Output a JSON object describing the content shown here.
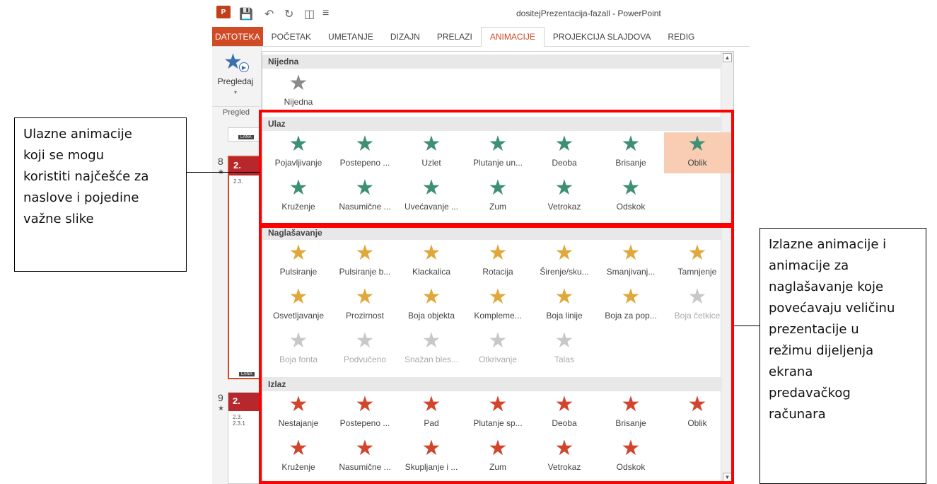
{
  "titlebar": {
    "app_icon_label": "P",
    "undo_icon": "undo-icon",
    "title": "dositejPrezentacija-fazall - PowerPoint"
  },
  "tabs": [
    {
      "label": "DATOTEKA"
    },
    {
      "label": "POČETAK"
    },
    {
      "label": "UMETANJE"
    },
    {
      "label": "DIZAJN"
    },
    {
      "label": "PRELAZI"
    },
    {
      "label": "ANIMACIJE"
    },
    {
      "label": "PROJEKCIJA SLAJDOVA"
    },
    {
      "label": "REDIG"
    }
  ],
  "preview": {
    "label": "Pregledaj",
    "caret": "▾",
    "group_label": "Pregled"
  },
  "slides": [
    {
      "number": "8",
      "title": "2.",
      "sub": "2.3."
    },
    {
      "number": "9",
      "title": "2.",
      "sub": "2.3.\n2.3.1"
    }
  ],
  "gallery": {
    "none_section": {
      "title": "Nijedna",
      "items": [
        {
          "label": "Nijedna"
        }
      ]
    },
    "entrance": {
      "title": "Ulaz",
      "items": [
        {
          "label": "Pojavljivanje"
        },
        {
          "label": "Postepeno ..."
        },
        {
          "label": "Uzlet"
        },
        {
          "label": "Plutanje un..."
        },
        {
          "label": "Deoba"
        },
        {
          "label": "Brisanje"
        },
        {
          "label": "Oblik"
        },
        {
          "label": "Kruženje"
        },
        {
          "label": "Nasumične ..."
        },
        {
          "label": "Uvećavanje ..."
        },
        {
          "label": "Zum"
        },
        {
          "label": "Vetrokaz"
        },
        {
          "label": "Odskok"
        }
      ]
    },
    "emphasis": {
      "title": "Naglašavanje",
      "items": [
        {
          "label": "Pulsiranje"
        },
        {
          "label": "Pulsiranje b..."
        },
        {
          "label": "Klackalica"
        },
        {
          "label": "Rotacija"
        },
        {
          "label": "Širenje/sku..."
        },
        {
          "label": "Smanjivanj..."
        },
        {
          "label": "Tamnjenje"
        },
        {
          "label": "Osvetljavanje"
        },
        {
          "label": "Prozirnost"
        },
        {
          "label": "Boja objekta"
        },
        {
          "label": "Kompleme..."
        },
        {
          "label": "Boja linije"
        },
        {
          "label": "Boja za pop..."
        },
        {
          "label": "Boja četkice"
        },
        {
          "label": "Boja fonta"
        },
        {
          "label": "Podvučeno"
        },
        {
          "label": "Snažan bles..."
        },
        {
          "label": "Otkrivanje"
        },
        {
          "label": "Talas"
        }
      ]
    },
    "exit": {
      "title": "Izlaz",
      "items": [
        {
          "label": "Nestajanje"
        },
        {
          "label": "Postepeno ..."
        },
        {
          "label": "Pad"
        },
        {
          "label": "Plutanje sp..."
        },
        {
          "label": "Deoba"
        },
        {
          "label": "Brisanje"
        },
        {
          "label": "Oblik"
        },
        {
          "label": "Kruženje"
        },
        {
          "label": "Nasumične ..."
        },
        {
          "label": "Skupljanje i ..."
        },
        {
          "label": "Zum"
        },
        {
          "label": "Vetrokaz"
        },
        {
          "label": "Odskok"
        }
      ]
    }
  },
  "colors": {
    "entrance_star": "#3e8f73",
    "emphasis_star": "#e0a83a",
    "exit_star": "#d2452c",
    "none_star": "#8a8a8a",
    "disabled_star": "#c8c8c8",
    "accent": "#d04a26",
    "highlight": "#ff0000"
  },
  "callouts": {
    "left": [
      "Ulazne animacije",
      "koji se mogu",
      "koristiti najčešće za",
      "naslove i pojedine",
      "važne slike"
    ],
    "right": [
      "Izlazne animacije i",
      "animacije za",
      "naglašavanje  koje",
      "povećavaju veličinu",
      "prezentacije u",
      "režimu dijeljenja",
      "ekrana",
      "predavačkog",
      "računara"
    ]
  }
}
